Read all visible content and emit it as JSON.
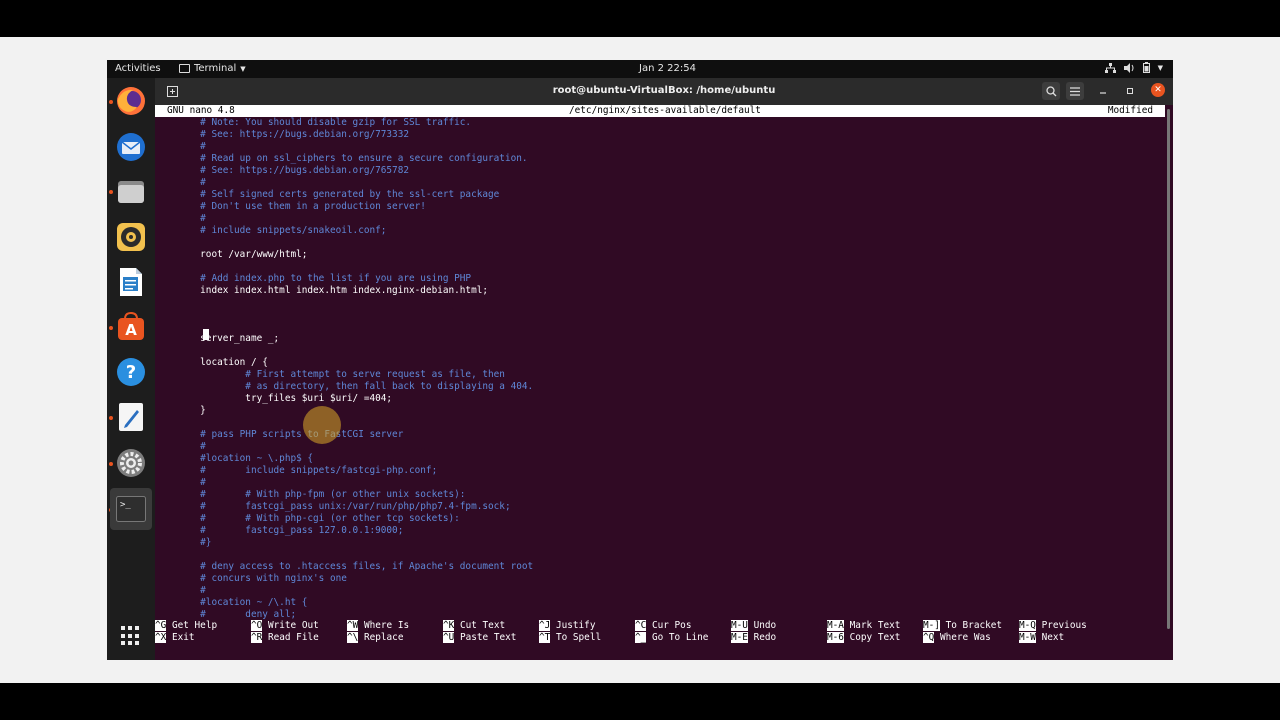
{
  "topbar": {
    "activities": "Activities",
    "app_menu": "Terminal",
    "clock": "Jan 2  22:54"
  },
  "dock": {
    "items": [
      {
        "name": "firefox-icon"
      },
      {
        "name": "thunderbird-icon"
      },
      {
        "name": "files-icon"
      },
      {
        "name": "rhythmbox-icon"
      },
      {
        "name": "libreoffice-writer-icon"
      },
      {
        "name": "software-center-icon"
      },
      {
        "name": "help-icon"
      },
      {
        "name": "text-editor-icon"
      },
      {
        "name": "settings-icon"
      },
      {
        "name": "terminal-icon"
      }
    ]
  },
  "window": {
    "title": "root@ubuntu-VirtualBox: /home/ubuntu"
  },
  "nano": {
    "version": "GNU nano 4.8",
    "file": "/etc/nginx/sites-available/default",
    "status": "Modified",
    "lines": [
      {
        "text": "        # Note: You should disable gzip for SSL traffic.",
        "kind": "comment"
      },
      {
        "text": "        # See: https://bugs.debian.org/773332",
        "kind": "comment"
      },
      {
        "text": "        #",
        "kind": "comment"
      },
      {
        "text": "        # Read up on ssl_ciphers to ensure a secure configuration.",
        "kind": "comment"
      },
      {
        "text": "        # See: https://bugs.debian.org/765782",
        "kind": "comment"
      },
      {
        "text": "        #",
        "kind": "comment"
      },
      {
        "text": "        # Self signed certs generated by the ssl-cert package",
        "kind": "comment"
      },
      {
        "text": "        # Don't use them in a production server!",
        "kind": "comment"
      },
      {
        "text": "        #",
        "kind": "comment"
      },
      {
        "text": "        # include snippets/snakeoil.conf;",
        "kind": "comment"
      },
      {
        "text": "",
        "kind": "code"
      },
      {
        "text": "        root /var/www/html;",
        "kind": "code"
      },
      {
        "text": "",
        "kind": "code"
      },
      {
        "text": "        # Add index.php to the list if you are using PHP",
        "kind": "comment"
      },
      {
        "text": "        index index.html index.htm index.nginx-debian.html;",
        "kind": "code"
      },
      {
        "text": "",
        "kind": "code"
      },
      {
        "text": "",
        "kind": "code"
      },
      {
        "text": "",
        "kind": "code"
      },
      {
        "text": "        server_name _;",
        "kind": "code"
      },
      {
        "text": "",
        "kind": "code"
      },
      {
        "text": "        location / {",
        "kind": "code"
      },
      {
        "text": "                # First attempt to serve request as file, then",
        "kind": "comment"
      },
      {
        "text": "                # as directory, then fall back to displaying a 404.",
        "kind": "comment"
      },
      {
        "text": "                try_files $uri $uri/ =404;",
        "kind": "code"
      },
      {
        "text": "        }",
        "kind": "code"
      },
      {
        "text": "",
        "kind": "code"
      },
      {
        "text": "        # pass PHP scripts to FastCGI server",
        "kind": "comment"
      },
      {
        "text": "        #",
        "kind": "comment"
      },
      {
        "text": "        #location ~ \\.php$ {",
        "kind": "comment"
      },
      {
        "text": "        #       include snippets/fastcgi-php.conf;",
        "kind": "comment"
      },
      {
        "text": "        #",
        "kind": "comment"
      },
      {
        "text": "        #       # With php-fpm (or other unix sockets):",
        "kind": "comment"
      },
      {
        "text": "        #       fastcgi_pass unix:/var/run/php/php7.4-fpm.sock;",
        "kind": "comment"
      },
      {
        "text": "        #       # With php-cgi (or other tcp sockets):",
        "kind": "comment"
      },
      {
        "text": "        #       fastcgi_pass 127.0.0.1:9000;",
        "kind": "comment"
      },
      {
        "text": "        #}",
        "kind": "comment"
      },
      {
        "text": "",
        "kind": "code"
      },
      {
        "text": "        # deny access to .htaccess files, if Apache's document root",
        "kind": "comment"
      },
      {
        "text": "        # concurs with nginx's one",
        "kind": "comment"
      },
      {
        "text": "        #",
        "kind": "comment"
      },
      {
        "text": "        #location ~ /\\.ht {",
        "kind": "comment"
      },
      {
        "text": "        #       deny all;",
        "kind": "comment"
      }
    ],
    "shortcuts": [
      [
        {
          "key": "^G",
          "label": "Get Help"
        },
        {
          "key": "^X",
          "label": "Exit"
        }
      ],
      [
        {
          "key": "^O",
          "label": "Write Out"
        },
        {
          "key": "^R",
          "label": "Read File"
        }
      ],
      [
        {
          "key": "^W",
          "label": "Where Is"
        },
        {
          "key": "^\\",
          "label": "Replace"
        }
      ],
      [
        {
          "key": "^K",
          "label": "Cut Text"
        },
        {
          "key": "^U",
          "label": "Paste Text"
        }
      ],
      [
        {
          "key": "^J",
          "label": "Justify"
        },
        {
          "key": "^T",
          "label": "To Spell"
        }
      ],
      [
        {
          "key": "^C",
          "label": "Cur Pos"
        },
        {
          "key": "^_",
          "label": "Go To Line"
        }
      ],
      [
        {
          "key": "M-U",
          "label": "Undo"
        },
        {
          "key": "M-E",
          "label": "Redo"
        }
      ],
      [
        {
          "key": "M-A",
          "label": "Mark Text"
        },
        {
          "key": "M-6",
          "label": "Copy Text"
        }
      ],
      [
        {
          "key": "M-]",
          "label": "To Bracket"
        },
        {
          "key": "^Q",
          "label": "Where Was"
        }
      ],
      [
        {
          "key": "M-Q",
          "label": "Previous"
        },
        {
          "key": "M-W",
          "label": "Next"
        }
      ]
    ]
  },
  "colors": {
    "terminal_bg": "#300a24",
    "comment": "#5f87d7",
    "ubuntu_orange": "#e95420"
  }
}
